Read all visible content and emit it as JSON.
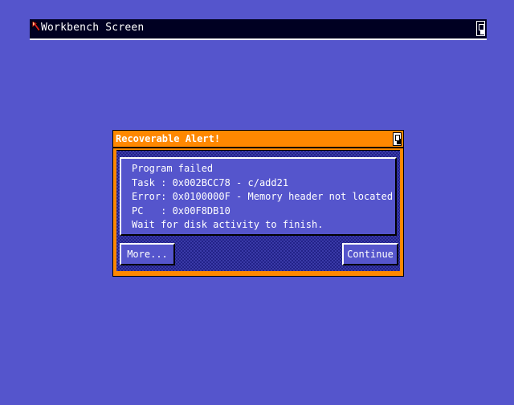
{
  "screen": {
    "title": "Workbench Screen"
  },
  "alert": {
    "title": "Recoverable Alert!",
    "lines": [
      "Program failed",
      "Task : 0x002BCC78 - c/add21",
      "Error: 0x0100000F - Memory header not located",
      "PC   : 0x00F8DB10",
      "Wait for disk activity to finish."
    ],
    "buttons": {
      "more": "More...",
      "continue": "Continue"
    }
  },
  "colors": {
    "screen_background": "#5555cc",
    "titlebar_background": "#000022",
    "alert_accent": "#ff8800",
    "text": "#ffffff"
  },
  "icons": {
    "pointer": "mouse-pointer-icon",
    "screen_depth": "depth-arrange-icon",
    "window_depth": "depth-arrange-icon"
  }
}
